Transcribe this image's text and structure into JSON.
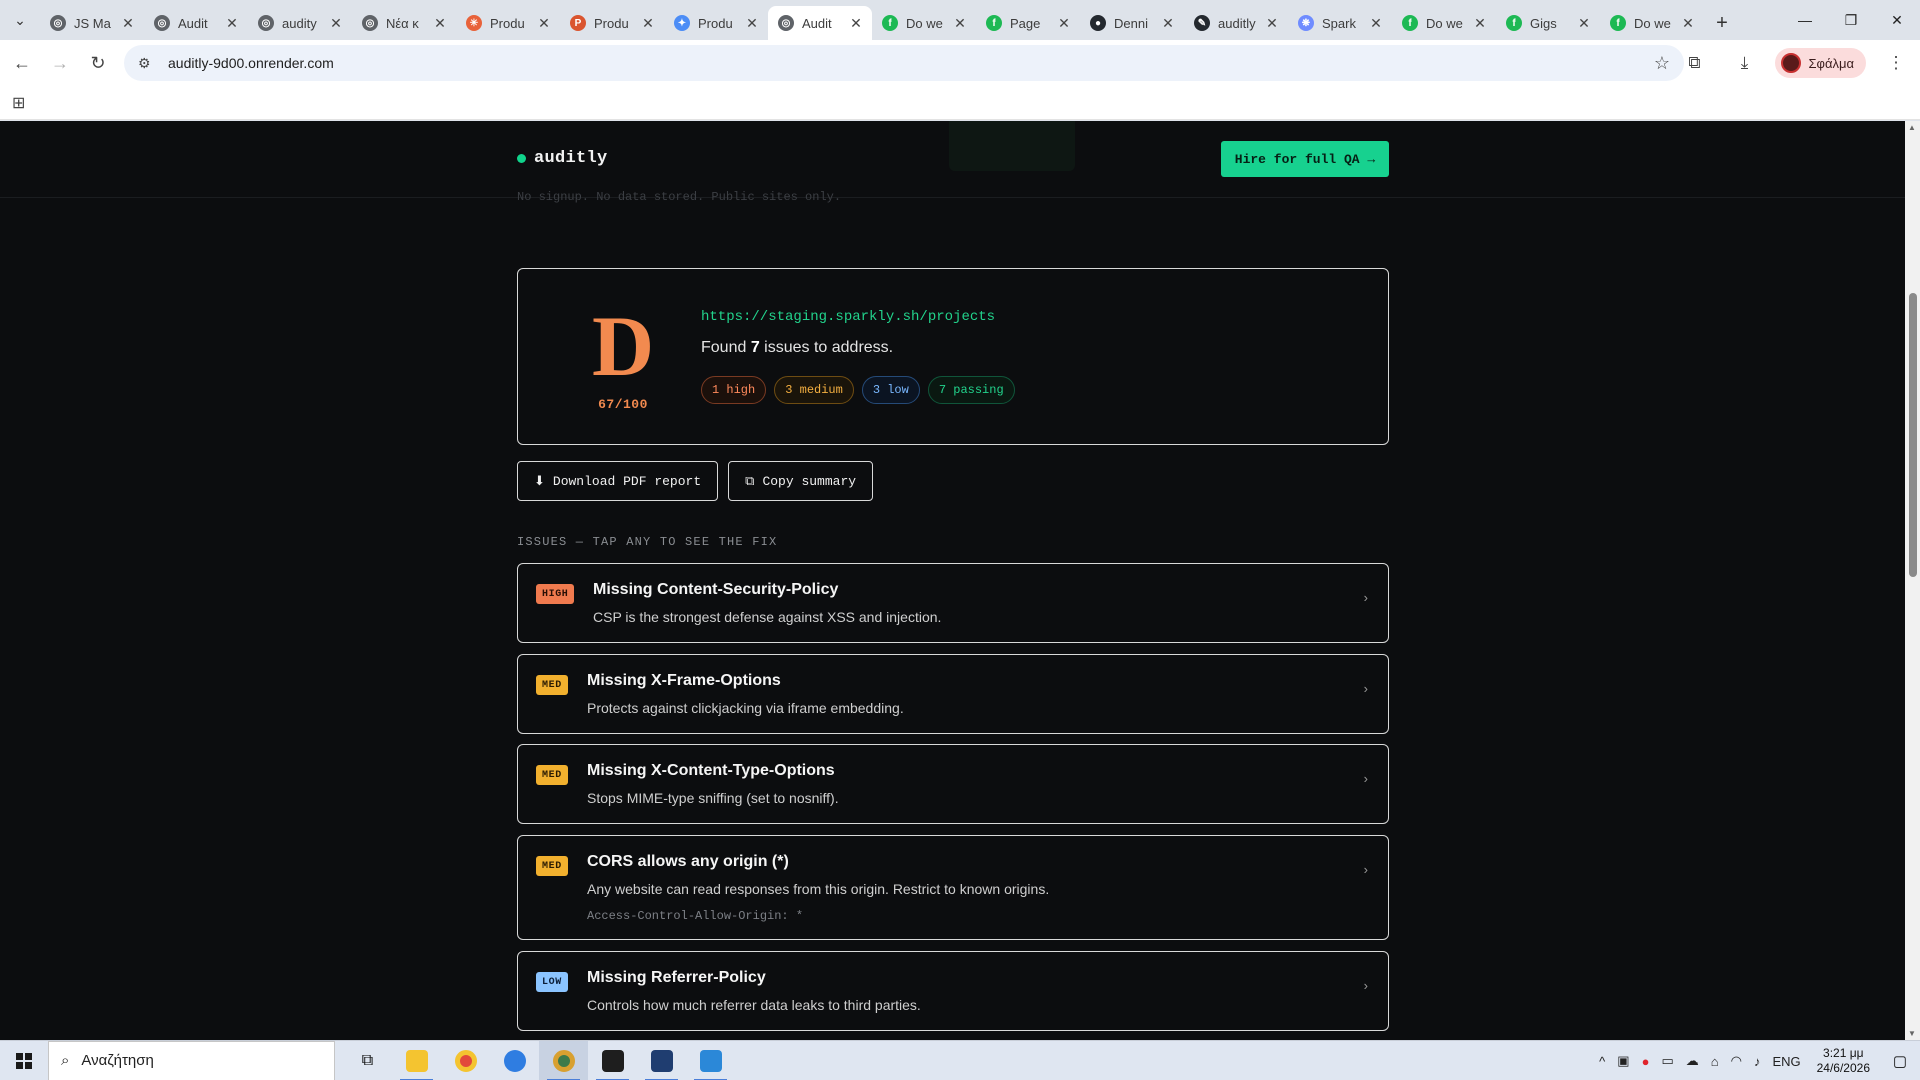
{
  "browser": {
    "tabs": [
      {
        "label": "JS Ma",
        "color": "#5f6368",
        "glyph": "◎"
      },
      {
        "label": "Audit",
        "color": "#5f6368",
        "glyph": "◎"
      },
      {
        "label": "audity",
        "color": "#5f6368",
        "glyph": "◎"
      },
      {
        "label": "Νέα κ",
        "color": "#5f6368",
        "glyph": "◎"
      },
      {
        "label": "Produ",
        "color": "#e8623a",
        "glyph": "✳"
      },
      {
        "label": "Produ",
        "color": "#da552f",
        "glyph": "P"
      },
      {
        "label": "Produ",
        "color": "#4c8df6",
        "glyph": "✦"
      },
      {
        "label": "Audit",
        "color": "#5f6368",
        "glyph": "◎",
        "active": true
      },
      {
        "label": "Do we",
        "color": "#1db954",
        "glyph": "f"
      },
      {
        "label": "Page",
        "color": "#1db954",
        "glyph": "f"
      },
      {
        "label": "Denni",
        "color": "#24292f",
        "glyph": "●"
      },
      {
        "label": "auditly",
        "color": "#24292f",
        "glyph": "✎"
      },
      {
        "label": "Spark",
        "color": "#6f8cff",
        "glyph": "❋"
      },
      {
        "label": "Do we",
        "color": "#1db954",
        "glyph": "f"
      },
      {
        "label": "Gigs",
        "color": "#1db954",
        "glyph": "f"
      },
      {
        "label": "Do we",
        "color": "#1db954",
        "glyph": "f"
      }
    ],
    "url": "auditly-9d00.onrender.com",
    "profile_label": "Σφάλμα"
  },
  "site": {
    "brand": "auditly",
    "hire_button": "Hire for full QA →",
    "ghost_text": "No signup. No data stored. Public sites only."
  },
  "report": {
    "grade": "D",
    "score": "67/100",
    "target_url": "https://staging.sparkly.sh/projects",
    "found_prefix": "Found ",
    "found_count": "7",
    "found_suffix": " issues to address.",
    "badges": {
      "high": "1 high",
      "medium": "3 medium",
      "low": "3 low",
      "passing": "7 passing"
    },
    "download_button": "Download PDF report",
    "copy_button": "Copy summary",
    "issues_heading": "ISSUES — TAP ANY TO SEE THE FIX"
  },
  "issues": [
    {
      "severity": "HIGH",
      "title": "Missing Content-Security-Policy",
      "desc": "CSP is the strongest defense against XSS and injection.",
      "code": ""
    },
    {
      "severity": "MED",
      "title": "Missing X-Frame-Options",
      "desc": "Protects against clickjacking via iframe embedding.",
      "code": ""
    },
    {
      "severity": "MED",
      "title": "Missing X-Content-Type-Options",
      "desc": "Stops MIME-type sniffing (set to nosniff).",
      "code": ""
    },
    {
      "severity": "MED",
      "title": "CORS allows any origin (*)",
      "desc": "Any website can read responses from this origin. Restrict to known origins.",
      "code": "Access-Control-Allow-Origin: *"
    },
    {
      "severity": "LOW",
      "title": "Missing Referrer-Policy",
      "desc": "Controls how much referrer data leaks to third parties.",
      "code": ""
    }
  ],
  "taskbar": {
    "search_placeholder": "Αναζήτηση",
    "lang": "ENG",
    "time": "3:21 μμ",
    "date": "24/6/2026"
  },
  "colors": {
    "accent": "#17d18f",
    "grade": "#f28a4f",
    "page_bg": "#0c0d0f"
  }
}
